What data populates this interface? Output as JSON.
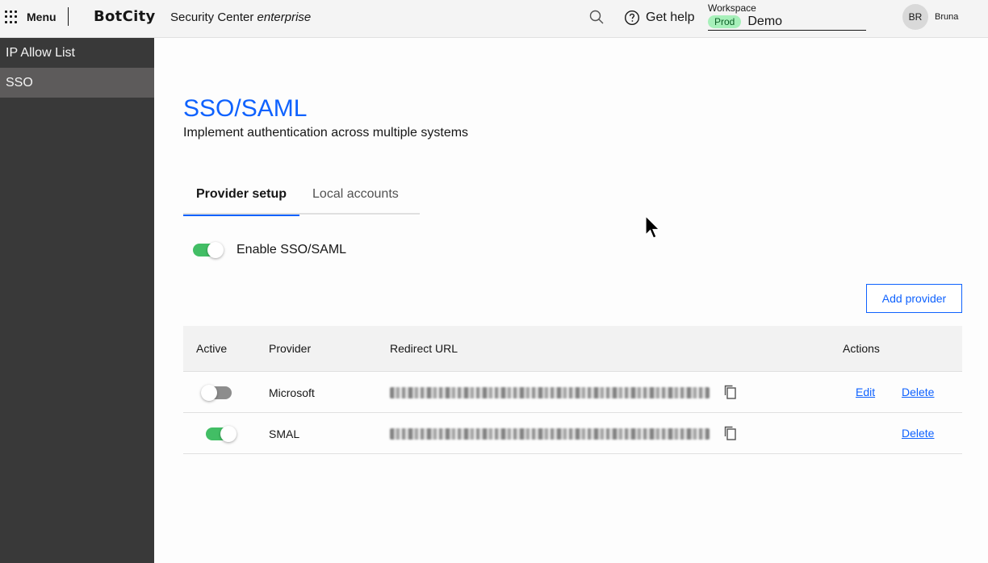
{
  "header": {
    "menu_label": "Menu",
    "logo_text": "BotCity",
    "app_name": "Security Center",
    "app_edition": "enterprise",
    "help_label": "Get help",
    "workspace_label": "Workspace",
    "workspace_env": "Prod",
    "workspace_name": "Demo",
    "user_initials": "BR",
    "user_name": "Bruna"
  },
  "sidebar": {
    "items": [
      {
        "label": "IP Allow List",
        "active": false
      },
      {
        "label": "SSO",
        "active": true
      }
    ]
  },
  "main": {
    "title": "SSO/SAML",
    "subtitle": "Implement authentication across multiple systems",
    "tabs": [
      {
        "label": "Provider setup",
        "active": true
      },
      {
        "label": "Local accounts",
        "active": false
      }
    ],
    "enable_label": "Enable SSO/SAML",
    "enable_on": true,
    "add_provider_label": "Add provider",
    "table": {
      "columns": [
        "Active",
        "Provider",
        "Redirect URL",
        "Actions"
      ],
      "rows": [
        {
          "active": false,
          "provider": "Microsoft",
          "actions": [
            "Edit",
            "Delete"
          ]
        },
        {
          "active": true,
          "provider": "SMAL",
          "actions": [
            "Delete"
          ]
        }
      ]
    }
  },
  "colors": {
    "accent": "#0f62fe",
    "toggle_on": "#42be65",
    "sidebar_bg": "#393939",
    "sidebar_active": "#5d5b5b",
    "env_badge": "#a7f0ba"
  },
  "icons": [
    "grid-menu-icon",
    "search-icon",
    "help-icon",
    "copy-icon",
    "cursor-icon"
  ]
}
